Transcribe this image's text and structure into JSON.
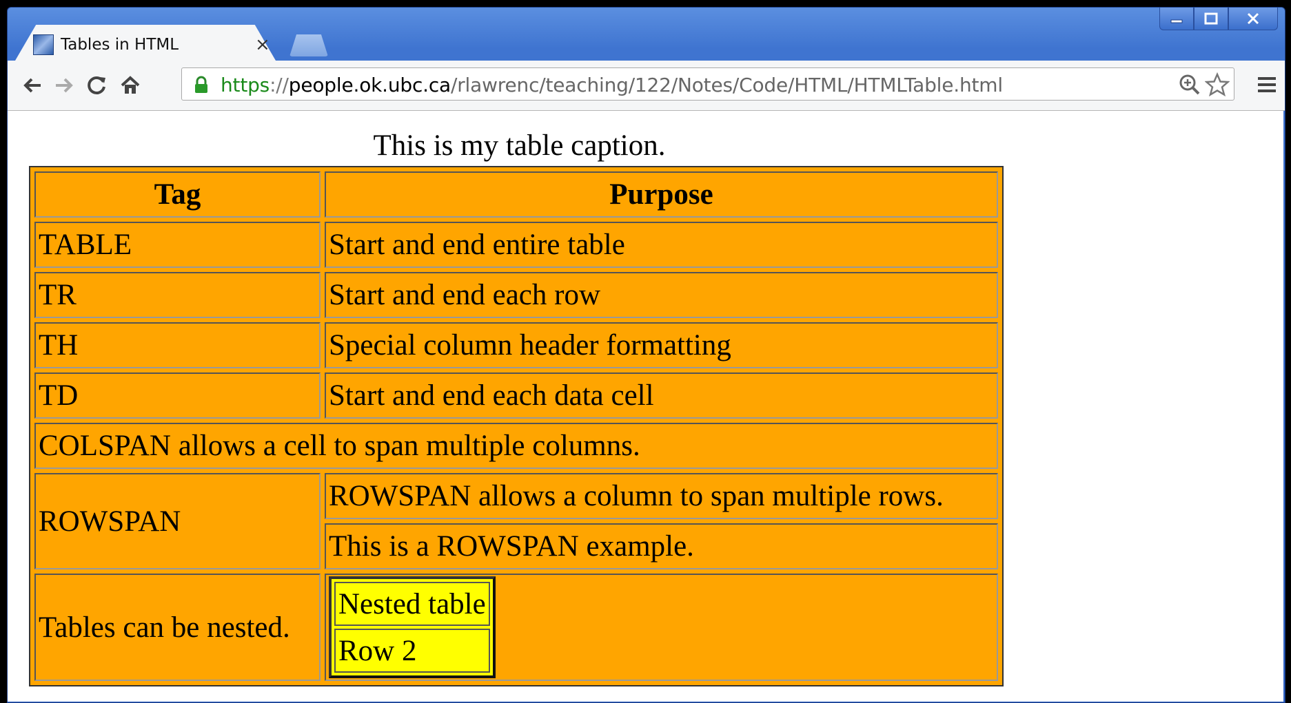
{
  "browser": {
    "tab_title": "Tables in HTML",
    "tab_close": "×",
    "url": {
      "scheme": "https",
      "separator": "://",
      "host": "people.ok.ubc.ca",
      "path": "/rlawrenc/teaching/122/Notes/Code/HTML/HTMLTable.html"
    },
    "icons": {
      "back": "back-arrow-icon",
      "forward": "forward-arrow-icon",
      "reload": "reload-icon",
      "home": "home-icon",
      "lock": "lock-icon",
      "zoom": "zoom-icon",
      "bookmark": "star-icon",
      "menu": "hamburger-menu-icon"
    },
    "accent_color": "#3f74d0"
  },
  "page": {
    "caption": "This is my table caption.",
    "table_bg": "#ffa500",
    "nested_bg": "#ffff00",
    "headers": {
      "tag": "Tag",
      "purpose": "Purpose"
    },
    "rows": [
      {
        "tag": "TABLE",
        "purpose": "Start and end entire table"
      },
      {
        "tag": "TR",
        "purpose": "Start and end each row"
      },
      {
        "tag": "TH",
        "purpose": "Special column header formatting"
      },
      {
        "tag": "TD",
        "purpose": "Start and end each data cell"
      }
    ],
    "colspan_row": "COLSPAN allows a cell to span multiple columns.",
    "rowspan": {
      "label": "ROWSPAN",
      "first": "ROWSPAN allows a column to span multiple rows.",
      "second": "This is a ROWSPAN example."
    },
    "nested": {
      "label": "Tables can be nested.",
      "cells": [
        "Nested table",
        "Row 2"
      ]
    }
  }
}
